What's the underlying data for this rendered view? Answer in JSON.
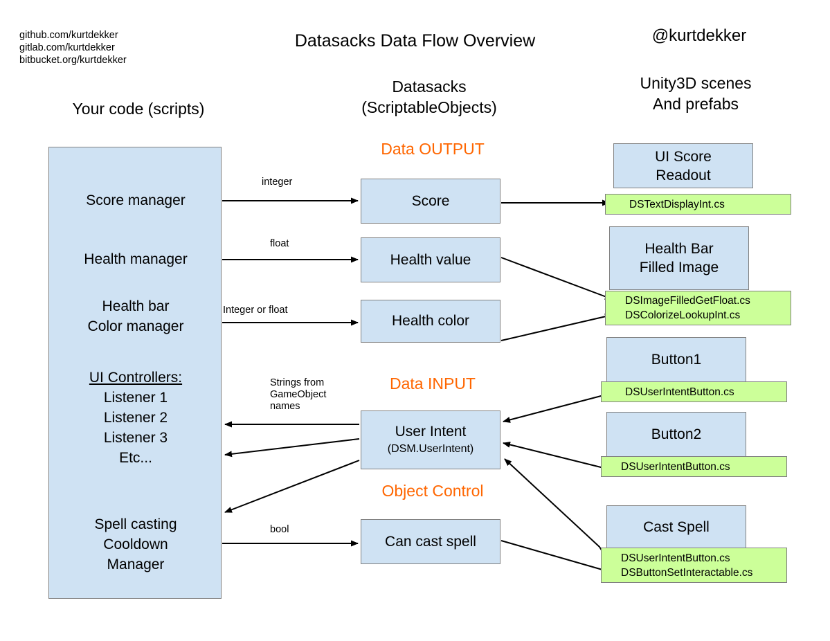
{
  "header": {
    "repos": "github.com/kurtdekker\ngitlab.com/kurtdekker\nbitbucket.org/kurtdekker",
    "title": "Datasacks Data Flow Overview",
    "handle": "@kurtdekker"
  },
  "columns": {
    "left": "Your code (scripts)",
    "middle": "Datasacks\n(ScriptableObjects)",
    "right": "Unity3D scenes\nAnd prefabs"
  },
  "sections": {
    "output": "Data OUTPUT",
    "input": "Data INPUT",
    "object_control": "Object Control"
  },
  "colors": {
    "box_blue": "#cfe2f3",
    "box_green": "#ccff99",
    "box_border": "#808080",
    "section_orange": "#ff6600",
    "line": "#000000"
  },
  "left_panel": {
    "items": [
      {
        "label": "Score manager"
      },
      {
        "label": "Health manager"
      },
      {
        "label": "Health bar\nColor manager"
      },
      {
        "label": "UI Controllers:"
      },
      {
        "label": "Listener 1"
      },
      {
        "label": "Listener 2"
      },
      {
        "label": "Listener 3"
      },
      {
        "label": "Etc..."
      },
      {
        "label": "Spell casting\nCooldown\nManager"
      }
    ]
  },
  "datasacks": [
    {
      "label": "Score"
    },
    {
      "label": "Health value"
    },
    {
      "label": "Health color"
    },
    {
      "label": "User Intent",
      "sublabel": "(DSM.UserIntent)"
    },
    {
      "label": "Can cast spell"
    }
  ],
  "scene_objects": [
    {
      "label": "UI Score\nReadout"
    },
    {
      "label": "Health Bar\nFilled Image"
    },
    {
      "label": "Button1"
    },
    {
      "label": "Button2"
    },
    {
      "label": "Cast Spell"
    }
  ],
  "scripts": {
    "score": [
      "DSTextDisplayInt.cs"
    ],
    "health": [
      "DSImageFilledGetFloat.cs",
      "DSColorizeLookupInt.cs"
    ],
    "button1": [
      "DSUserIntentButton.cs"
    ],
    "button2": [
      "DSUserIntentButton.cs"
    ],
    "cast_spell": [
      "DSUserIntentButton.cs",
      "DSButtonSetInteractable.cs"
    ]
  },
  "arrow_labels": {
    "integer": "integer",
    "float": "float",
    "integer_or_float": "Integer or float",
    "strings": "Strings from\nGameObject\nnames",
    "bool": "bool"
  }
}
